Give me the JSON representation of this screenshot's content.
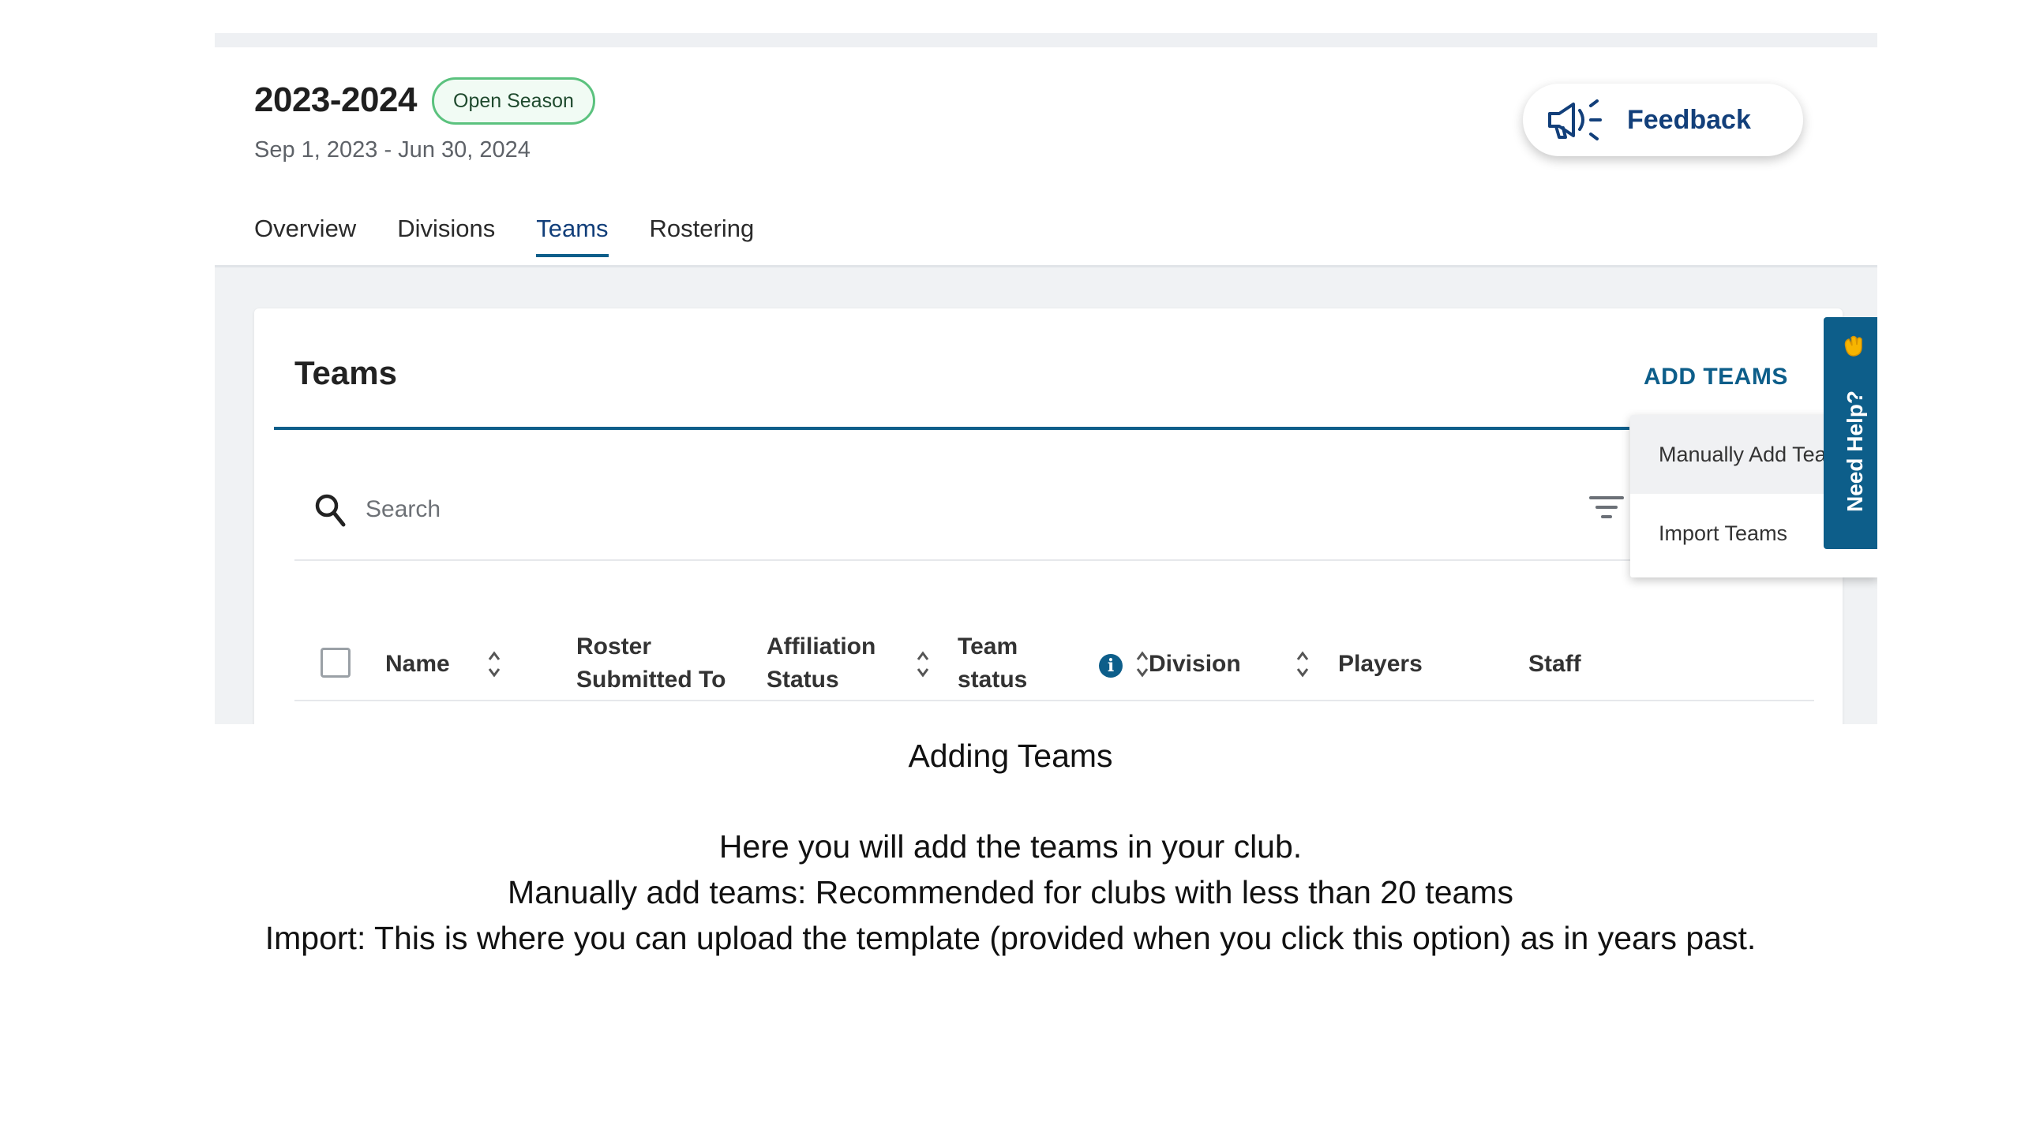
{
  "season": {
    "title": "2023-2024",
    "badge": "Open Season",
    "dates": "Sep 1, 2023 - Jun 30, 2024"
  },
  "feedback": {
    "label": "Feedback",
    "icon": "megaphone-icon"
  },
  "tabs": [
    {
      "label": "Overview",
      "active": false
    },
    {
      "label": "Divisions",
      "active": false
    },
    {
      "label": "Teams",
      "active": true
    },
    {
      "label": "Rostering",
      "active": false
    }
  ],
  "card": {
    "title": "Teams",
    "add_teams_label": "ADD TEAMS"
  },
  "search": {
    "placeholder": "Search",
    "value": ""
  },
  "table": {
    "columns": [
      {
        "line1": "Name",
        "line2": "",
        "sortable": true
      },
      {
        "line1": "Roster",
        "line2": "Submitted To",
        "sortable": false
      },
      {
        "line1": "Affiliation",
        "line2": "Status",
        "sortable": true
      },
      {
        "line1": "Team",
        "line2": "status",
        "sortable": true,
        "info": true
      },
      {
        "line1": "Division",
        "line2": "",
        "sortable": true
      },
      {
        "line1": "Players",
        "line2": "",
        "sortable": false
      },
      {
        "line1": "Staff",
        "line2": "",
        "sortable": false
      }
    ]
  },
  "add_teams_menu": {
    "items": [
      "Manually Add Teams",
      "Import Teams"
    ]
  },
  "help_tab": {
    "label": "Need Help?"
  },
  "caption": {
    "title": "Adding Teams",
    "line1": "Here you will add the teams in your club.",
    "line2": "Manually add teams: Recommended for clubs with less than 20 teams",
    "line3": "Import: This is where you can upload the template (provided when you click this option) as in years past."
  },
  "colors": {
    "accent": "#0d5e8a",
    "brand_dark": "#123f7a",
    "badge_border": "#5bc27e",
    "content_bg": "#f0f2f4"
  }
}
